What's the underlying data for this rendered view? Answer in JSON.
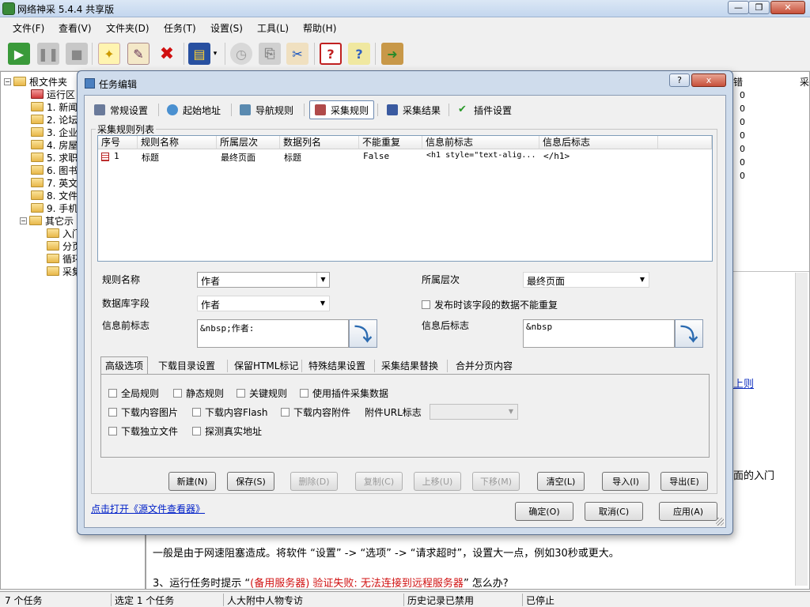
{
  "window": {
    "title": "网络神采 5.4.4 共享版"
  },
  "menu": [
    "文件(F)",
    "查看(V)",
    "文件夹(D)",
    "任务(T)",
    "设置(S)",
    "工具(L)",
    "帮助(H)"
  ],
  "tree": {
    "root": "根文件夹",
    "items": [
      "运行区",
      "1. 新闻",
      "2. 论坛",
      "3. 企业",
      "4. 房屋",
      "5. 求职",
      "6. 图书",
      "7. 英文",
      "8. 文件",
      "9. 手机"
    ],
    "group2": "其它示",
    "sub": [
      "入门",
      "分页",
      "循环",
      "采集"
    ]
  },
  "rightpane": {
    "col1": "错",
    "col2": "采",
    "zeros": [
      "0",
      "0",
      "0",
      "0",
      "0",
      "0",
      "0"
    ],
    "link_tail": "上则",
    "text_tail": "面的入门",
    "line1": "一般是由于网速阻塞造成。将软件 “设置” -> “选项” -> “请求超时”，设置大一点，例如30秒或更大。",
    "line2_pre": "3、运行任务时提示 “",
    "line2_red": "(备用服务器) 验证失败: 无法连接到远程服务器",
    "line2_post": "” 怎么办?"
  },
  "status": [
    "7 个任务",
    "选定 1 个任务",
    "人大附中人物专访",
    "历史记录已禁用",
    "已停止"
  ],
  "dialog": {
    "title": "任务编辑",
    "help": "?",
    "close": "x",
    "tabs": [
      "常规设置",
      "起始地址",
      "导航规则",
      "采集规则",
      "采集结果",
      "插件设置"
    ],
    "list_group": "采集规则列表",
    "columns": [
      "序号",
      "规则名称",
      "所属层次",
      "数据列名",
      "不能重复",
      "信息前标志",
      "信息后标志"
    ],
    "row": [
      "1",
      "标题",
      "最终页面",
      "标题",
      "False",
      "<h1 style=\"text-alig...",
      "</h1>"
    ],
    "rule_name_label": "规则名称",
    "rule_name": "作者",
    "level_label": "所属层次",
    "level": "最终页面",
    "db_field_label": "数据库字段",
    "db_field": "作者",
    "no_dup_label": "发布时该字段的数据不能重复",
    "prefix_label": "信息前标志",
    "prefix": "&nbsp;作者:",
    "suffix_label": "信息后标志",
    "suffix": "&nbsp",
    "subtabs": [
      "高级选项",
      "下载目录设置",
      "保留HTML标记",
      "特殊结果设置",
      "采集结果替换",
      "合并分页内容"
    ],
    "checks_row1": [
      "全局规则",
      "静态规则",
      "关键规则",
      "使用插件采集数据"
    ],
    "checks_row2": [
      "下载内容图片",
      "下载内容Flash",
      "下载内容附件"
    ],
    "attach_label": "附件URL标志",
    "checks_row3": [
      "下载独立文件",
      "探测真实地址"
    ],
    "buttons": [
      "新建(N)",
      "保存(S)",
      "删除(D)",
      "复制(C)",
      "上移(U)",
      "下移(M)",
      "清空(L)",
      "导入(I)",
      "导出(E)"
    ],
    "link": "点击打开《源文件查看器》",
    "ok": "确定(O)",
    "cancel": "取消(C)",
    "apply": "应用(A)"
  }
}
